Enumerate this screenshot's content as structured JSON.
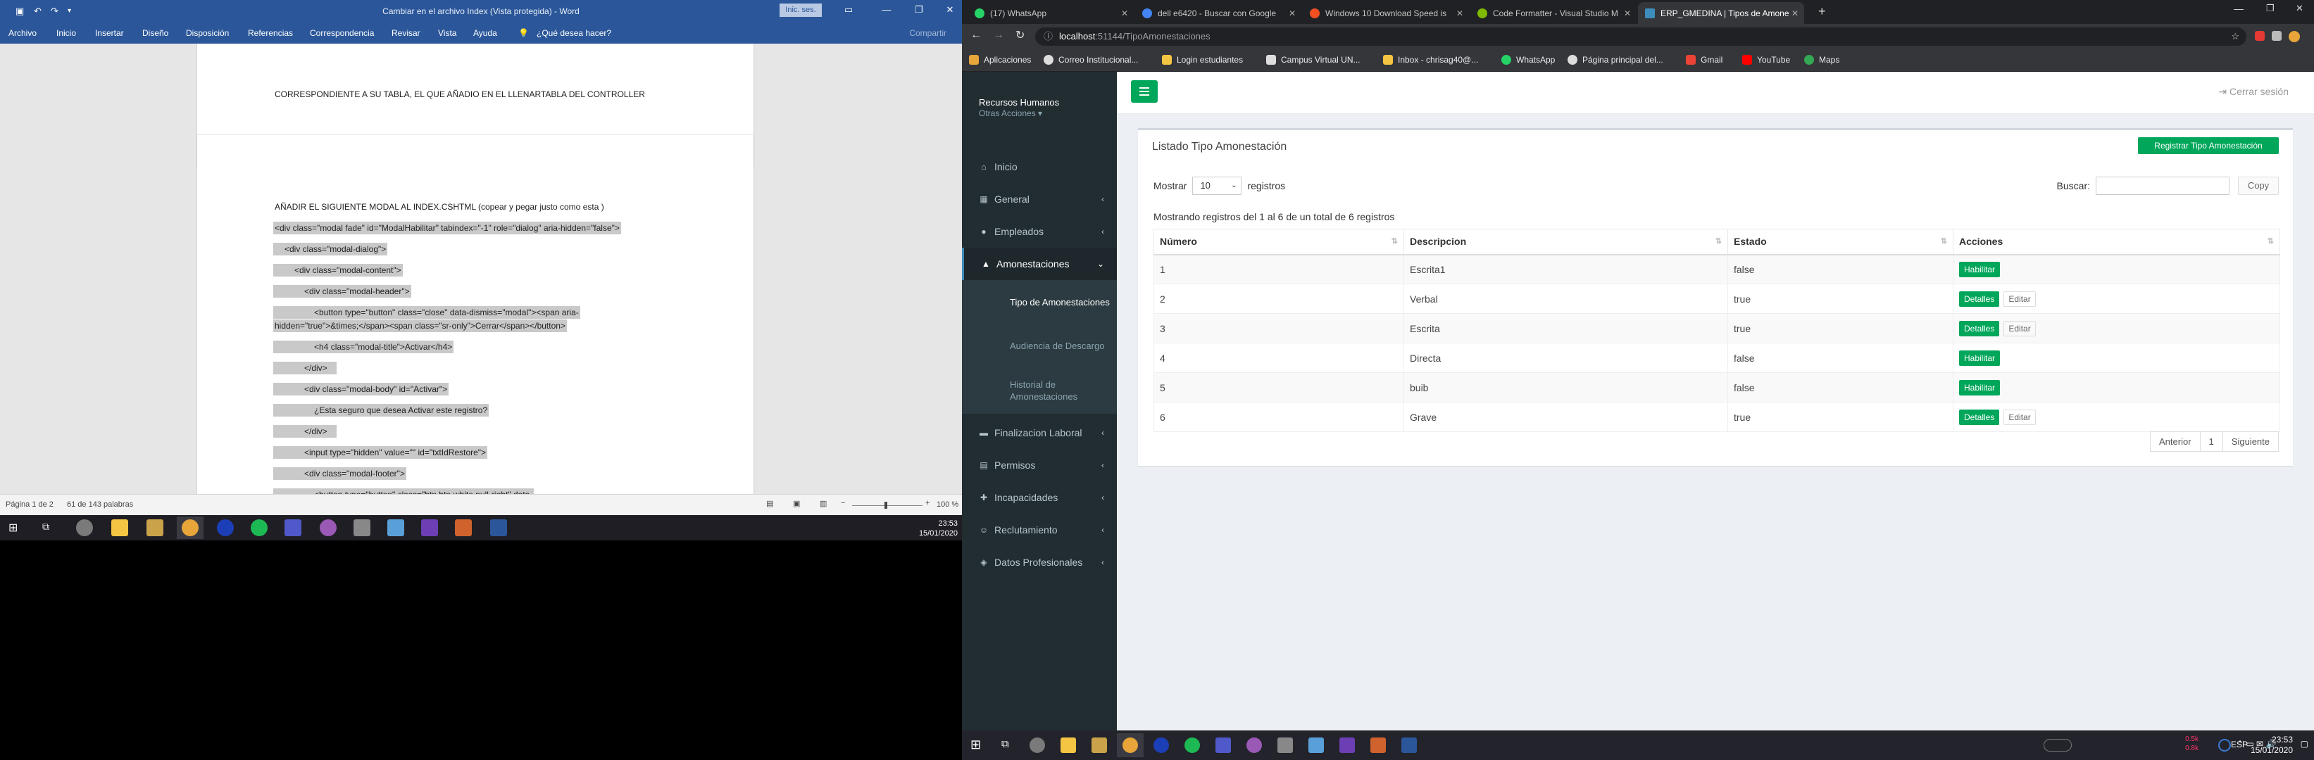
{
  "word": {
    "title": "Cambiar en el archivo Index (Vista protegida) - Word",
    "signin": "Inic. ses.",
    "share": "Compartir",
    "ribbon_tabs": [
      "Archivo",
      "Inicio",
      "Insertar",
      "Diseño",
      "Disposición",
      "Referencias",
      "Correspondencia",
      "Revisar",
      "Vista",
      "Ayuda",
      "¿Qué desea hacer?"
    ],
    "doc_lines": [
      "CORRESPONDIENTE A SU TABLA, EL QUE AÑADIO EN EL LLENARTABLA DEL CONTROLLER",
      "AÑADIR EL SIGUIENTE MODAL AL INDEX.CSHTML (copear y pegar justo como esta )",
      "<div class=\"modal fade\" id=\"ModalHabilitar\" tabindex=\"-1\" role=\"dialog\" aria-hidden=\"false\">",
      "<div class=\"modal-dialog\">",
      "<div class=\"modal-content\">",
      "<div class=\"modal-header\">",
      "<button type=\"button\" class=\"close\" data-dismiss=\"modal\"><span aria-",
      "hidden=\"true\">&times;</span><span class=\"sr-only\">Cerrar</span></button>",
      "<h4 class=\"modal-title\">Activar</h4>",
      "</div>",
      "<div class=\"modal-body\" id=\"Activar\">",
      "¿Esta seguro que desea Activar este registro?",
      "</div>",
      "<input type=\"hidden\" value=\"\" id=\"txtIdRestore\">",
      "<div class=\"modal-footer\">",
      "<button type=\"button\" class=\"btn btn-white pull-right\" data-"
    ],
    "status_page": "Página 1 de 2",
    "status_words": "61 de 143 palabras",
    "zoom": "100 %",
    "clock_time": "23:53",
    "clock_date": "15/01/2020"
  },
  "chrome": {
    "tabs": [
      {
        "title": "(17) WhatsApp",
        "color": "#25d366"
      },
      {
        "title": "dell e6420 - Buscar con Google",
        "color": "#4285f4"
      },
      {
        "title": "Windows 10 Download Speed is",
        "color": "#f25022"
      },
      {
        "title": "Code Formatter - Visual Studio M",
        "color": "#7fba00"
      },
      {
        "title": "ERP_GMEDINA | Tipos de Amone",
        "color": "#3c8dbc"
      }
    ],
    "url_host": "localhost",
    "url_path": ":51144/TipoAmonestaciones",
    "bookmarks": [
      "Aplicaciones",
      "Correo Institucional...",
      "Login estudiantes",
      "Campus Virtual UN...",
      "Inbox - chrisag40@...",
      "WhatsApp",
      "Página principal del...",
      "Gmail",
      "YouTube",
      "Maps"
    ]
  },
  "app": {
    "brand": "Recursos Humanos",
    "brand_sub": "Otras Acciones ▾",
    "logout": "Cerrar sesión",
    "menu": [
      {
        "label": "Inicio",
        "icon": "home-icon"
      },
      {
        "label": "General",
        "icon": "th-icon"
      },
      {
        "label": "Empleados",
        "icon": "users-icon"
      },
      {
        "label": "Amonestaciones",
        "icon": "warning-icon"
      }
    ],
    "submenu": [
      "Tipo de Amonestaciones",
      "Audiencia de Descargo",
      "Historial de Amonestaciones"
    ],
    "menu_bottom": [
      {
        "label": "Finalizacion Laboral",
        "icon": "briefcase-icon"
      },
      {
        "label": "Permisos",
        "icon": "calendar-icon"
      },
      {
        "label": "Incapacidades",
        "icon": "medkit-icon"
      },
      {
        "label": "Reclutamiento",
        "icon": "user-plus-icon"
      },
      {
        "label": "Datos Profesionales",
        "icon": "graduation-icon"
      }
    ],
    "box_title": "Listado Tipo Amonestación",
    "register_button": "Registrar Tipo Amonestación",
    "show_label": "Mostrar",
    "show_value": "10",
    "records_label": "registros",
    "search_label": "Buscar:",
    "copy_button": "Copy",
    "info": "Mostrando registros del 1 al 6 de un total de 6 registros",
    "columns": [
      "Número",
      "Descripcion",
      "Estado",
      "Acciones"
    ],
    "rows": [
      {
        "num": "1",
        "desc": "Escrita1",
        "estado": "false",
        "actions": [
          "Habilitar"
        ]
      },
      {
        "num": "2",
        "desc": "Verbal",
        "estado": "true",
        "actions": [
          "Detalles",
          "Editar"
        ]
      },
      {
        "num": "3",
        "desc": "Escrita",
        "estado": "true",
        "actions": [
          "Detalles",
          "Editar"
        ]
      },
      {
        "num": "4",
        "desc": "Directa",
        "estado": "false",
        "actions": [
          "Habilitar"
        ]
      },
      {
        "num": "5",
        "desc": "buib",
        "estado": "false",
        "actions": [
          "Habilitar"
        ]
      },
      {
        "num": "6",
        "desc": "Grave",
        "estado": "true",
        "actions": [
          "Detalles",
          "Editar"
        ]
      }
    ],
    "pager": [
      "Anterior",
      "1",
      "Siguiente"
    ]
  },
  "taskbar": {
    "clock_time": "23:53",
    "clock_date": "15/01/2020",
    "lang": "ESP",
    "net_up": "0.5k",
    "net_down": "0.8k"
  },
  "colors": {
    "word_blue": "#2b579a",
    "green": "#00a65a",
    "sidebar": "#222d32"
  }
}
